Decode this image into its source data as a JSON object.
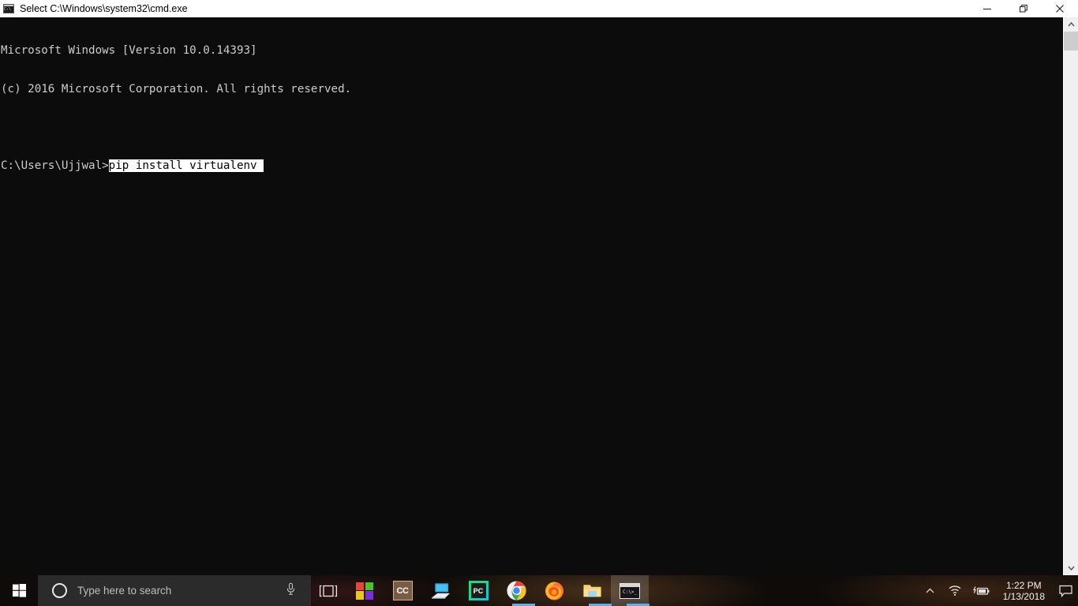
{
  "window": {
    "title": "Select C:\\Windows\\system32\\cmd.exe",
    "icon": "cmd-console-icon",
    "icon_text": "C:\\",
    "controls": {
      "minimize": "Minimize",
      "restore": "Restore",
      "close": "Close"
    }
  },
  "console": {
    "lines": [
      {
        "text": "Microsoft Windows [Version 10.0.14393]"
      },
      {
        "text": "(c) 2016 Microsoft Corporation. All rights reserved."
      },
      {
        "text": ""
      },
      {
        "prompt": "C:\\Users\\Ujjwal>",
        "command": "pip install virtualenv ",
        "selected": true
      }
    ],
    "background_color": "#0c0c0c",
    "text_color": "#cccccc",
    "selection_background": "#ffffff",
    "selection_text": "#000000"
  },
  "scrollbar": {
    "up_arrow": "scroll-up",
    "down_arrow": "scroll-down",
    "thumb": "scroll-thumb"
  },
  "taskbar": {
    "start": "Start",
    "search": {
      "placeholder": "Type here to search",
      "cortana_icon": "cortana-circle-icon",
      "mic_icon": "microphone-icon"
    },
    "task_view": "Task View",
    "apps": [
      {
        "name": "microsoft-store",
        "label": "Microsoft Store",
        "active": false,
        "running": false
      },
      {
        "name": "cc-app",
        "label": "CC",
        "active": false,
        "running": false
      },
      {
        "name": "this-pc",
        "label": "This PC",
        "active": false,
        "running": false
      },
      {
        "name": "pycharm",
        "label": "PyCharm",
        "short": "PC",
        "active": false,
        "running": false
      },
      {
        "name": "google-chrome",
        "label": "Google Chrome",
        "active": false,
        "running": true
      },
      {
        "name": "mozilla-firefox",
        "label": "Mozilla Firefox",
        "active": false,
        "running": false
      },
      {
        "name": "file-explorer",
        "label": "File Explorer",
        "active": false,
        "running": true
      },
      {
        "name": "command-prompt",
        "label": "Command Prompt",
        "active": true,
        "running": true
      }
    ],
    "tray": {
      "show_hidden": "show-hidden-icons",
      "network": "wifi-icon",
      "battery": "battery-charging-icon",
      "time": "1:22 PM",
      "date": "1/13/2018",
      "action_center": "action-center-icon"
    }
  },
  "colors": {
    "taskbar_bg": "#0e0b09",
    "search_bg": "#2b2b2b",
    "accent_underline": "#5aaff0",
    "titlebar_bg": "#ffffff"
  }
}
